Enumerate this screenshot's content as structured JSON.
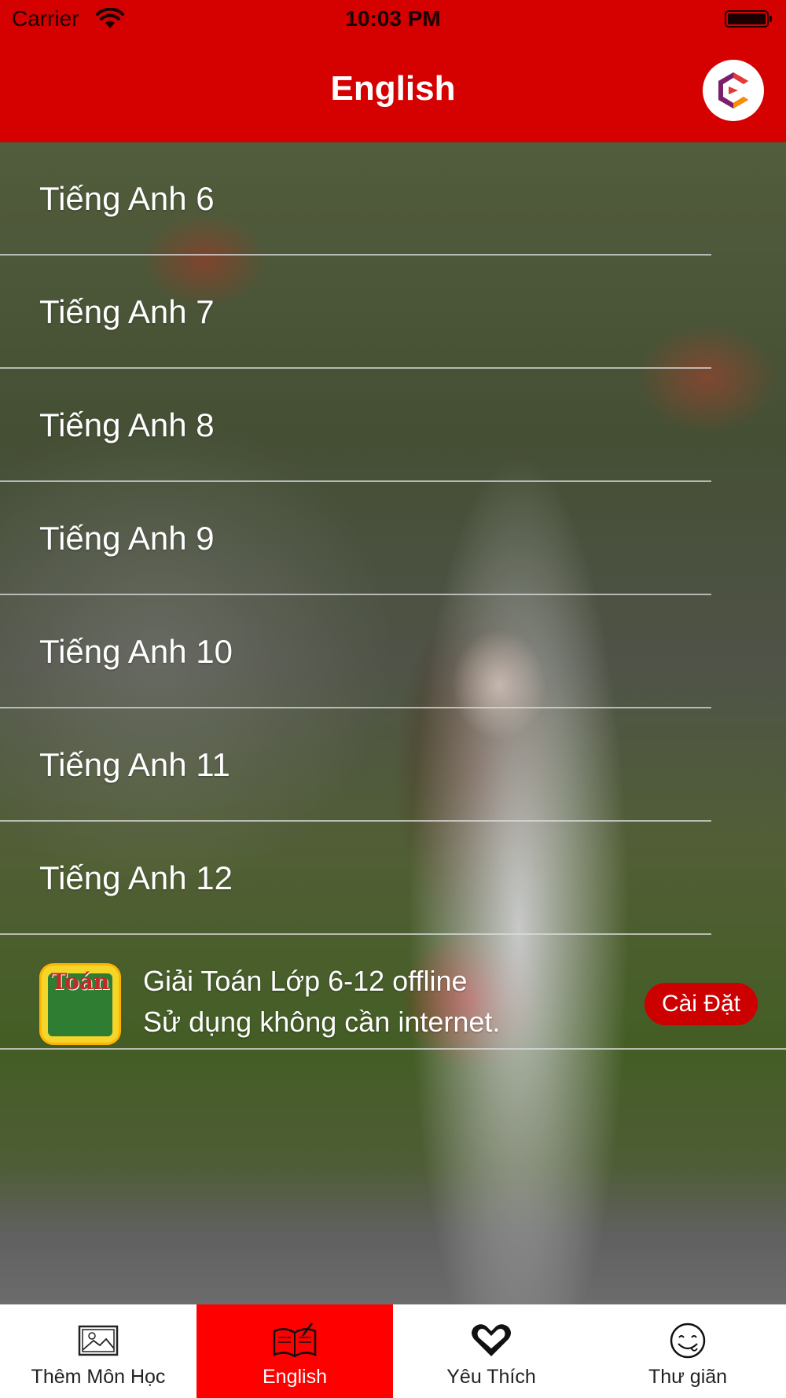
{
  "status_bar": {
    "carrier": "Carrier",
    "time": "10:03 PM"
  },
  "nav": {
    "title": "English",
    "logo_icon": "app-logo-icon"
  },
  "colors": {
    "accent": "#d50000",
    "tab_active": "#ff0000",
    "ad_button": "#cc0000"
  },
  "list": {
    "items": [
      {
        "label": "Tiếng Anh 6"
      },
      {
        "label": "Tiếng Anh 7"
      },
      {
        "label": "Tiếng Anh 8"
      },
      {
        "label": "Tiếng Anh 9"
      },
      {
        "label": "Tiếng Anh 10"
      },
      {
        "label": "Tiếng Anh 11"
      },
      {
        "label": "Tiếng Anh 12"
      }
    ]
  },
  "ad": {
    "icon_text": "Toán",
    "title": "Giải Toán Lớp 6-12 offline",
    "subtitle": "Sử dụng không cần internet.",
    "button_label": "Cài Đặt"
  },
  "tabs": [
    {
      "label": "Thêm Môn Học",
      "icon": "image-gallery-icon",
      "active": false
    },
    {
      "label": "English",
      "icon": "book-icon",
      "active": true
    },
    {
      "label": "Yêu Thích",
      "icon": "heart-icon",
      "active": false
    },
    {
      "label": "Thư giãn",
      "icon": "smiley-icon",
      "active": false
    }
  ]
}
